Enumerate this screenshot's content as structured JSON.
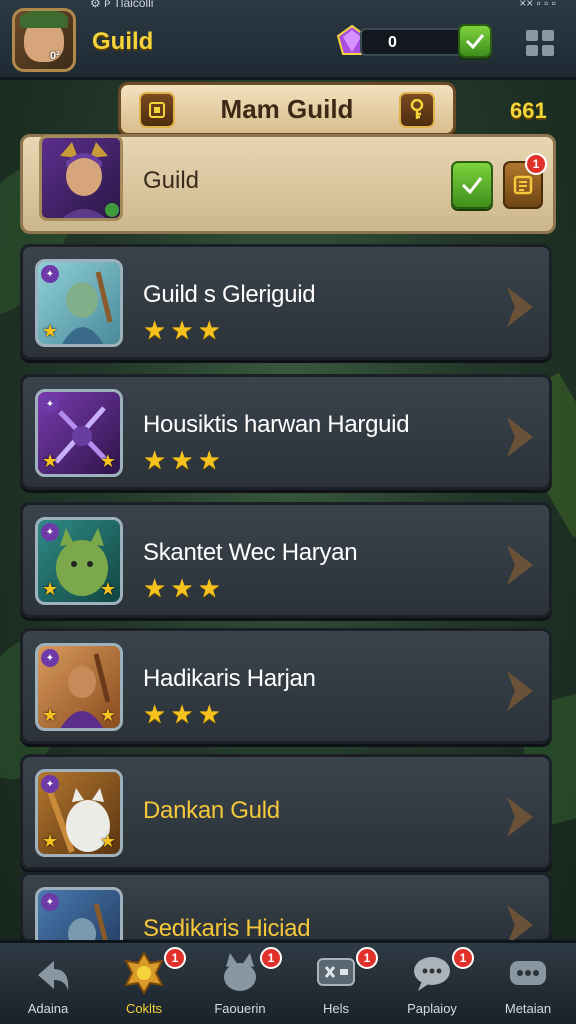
{
  "status_bar": {
    "left": "⚙ ᴘ Tlaicolli",
    "right": "×× ▫ ▫ ▫"
  },
  "player": {
    "badge": "0²"
  },
  "header": {
    "title": "Guild",
    "currency_value": "0"
  },
  "banner": {
    "title": "Mam Guild",
    "score": "661"
  },
  "featured": {
    "name": "Guild",
    "notification_count": "1"
  },
  "guild_list": [
    {
      "name": "Guild s Gleriguid",
      "stars": 3,
      "portrait_colors": [
        "#8fd0d8",
        "#4a8a9a"
      ]
    },
    {
      "name": "Housiktis harwan Harguid",
      "stars": 3,
      "portrait_colors": [
        "#7a3bb0",
        "#2e1449"
      ]
    },
    {
      "name": "Skantet Wec Haryan",
      "stars": 3,
      "portrait_colors": [
        "#2f8a86",
        "#124642"
      ]
    },
    {
      "name": "Hadikaris Harjan",
      "stars": 3,
      "portrait_colors": [
        "#d79a5c",
        "#8a4b1e"
      ]
    },
    {
      "name": "Dankan Guld",
      "stars": 0,
      "highlight": true,
      "portrait_colors": [
        "#b3762f",
        "#5a3510"
      ]
    },
    {
      "name": "Sedikaris Hiciad",
      "stars": 0,
      "highlight": true,
      "portrait_colors": [
        "#4a7ab0",
        "#1e3658"
      ]
    }
  ],
  "bottom_nav": [
    {
      "label": "Adaina",
      "notification": ""
    },
    {
      "label": "Coklts",
      "notification": "1",
      "active": true
    },
    {
      "label": "Faouerin",
      "notification": "1"
    },
    {
      "label": "Hels",
      "notification": "1"
    },
    {
      "label": "Paplaioy",
      "notification": "1"
    },
    {
      "label": "Metaian",
      "notification": ""
    }
  ],
  "colors": {
    "accent_gold": "#f5d43a",
    "button_green": "#5cb82a",
    "notification_red": "#e0302a",
    "row_bg": "#333b43"
  }
}
